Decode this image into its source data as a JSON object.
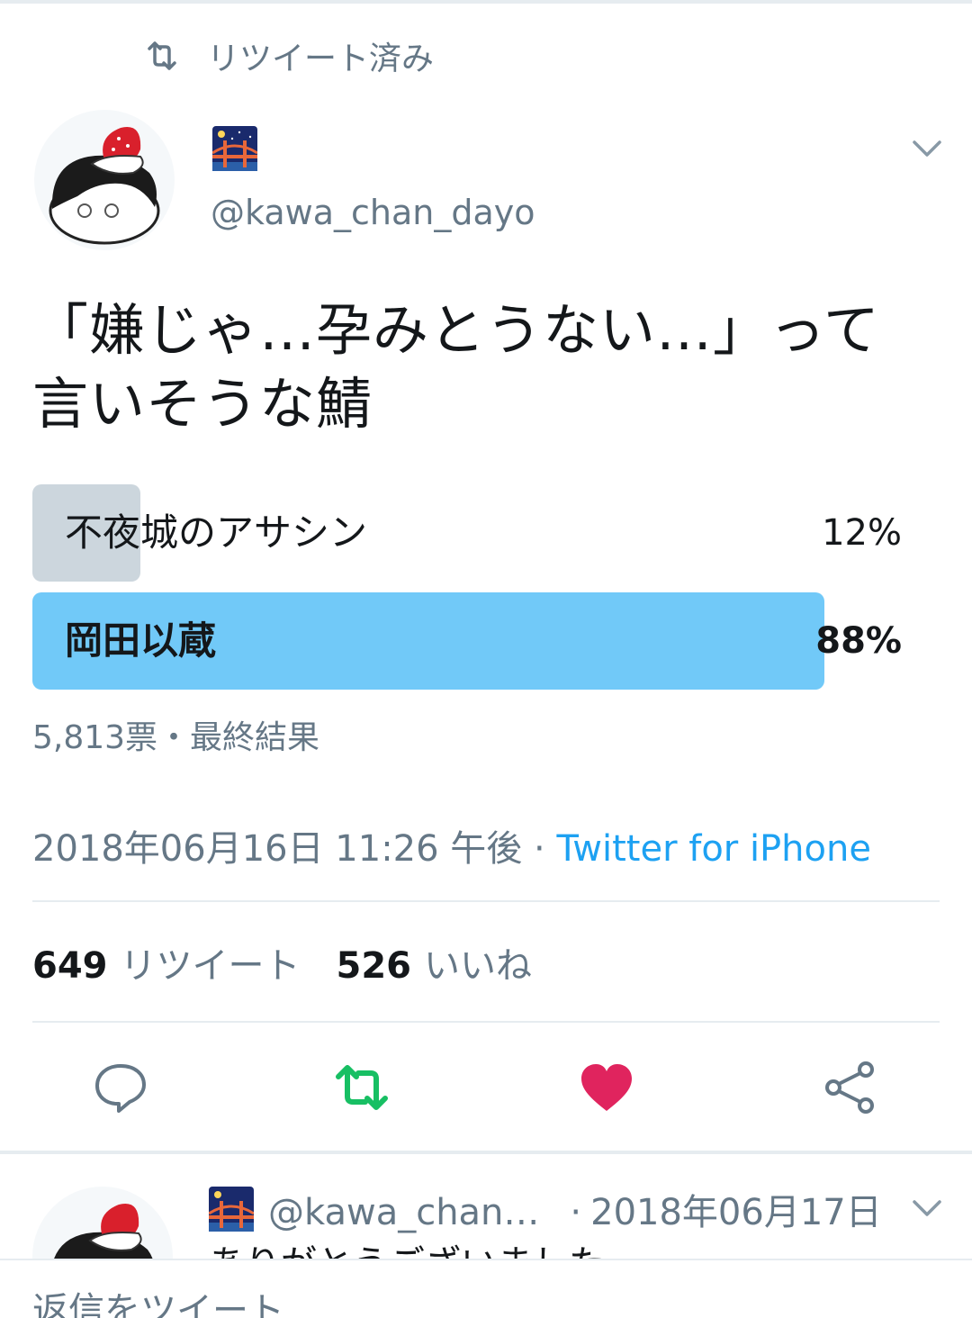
{
  "retweet_indicator": {
    "label": "リツイート済み",
    "icon": "retweet-icon"
  },
  "tweet": {
    "display_name_emoji": "bridge-at-night-emoji",
    "handle": "@kawa_chan_dayo",
    "text": "「嫌じゃ…孕みとうない…」って言いそうな鯖",
    "poll": {
      "options": [
        {
          "label": "不夜城のアサシン",
          "percent_label": "12%",
          "percent": 12
        },
        {
          "label": "岡田以蔵",
          "percent_label": "88%",
          "percent": 88
        }
      ],
      "summary": "5,813票・最終結果"
    },
    "timestamp": "2018年06月16日 11:26 午後",
    "separator": " · ",
    "source": "Twitter for iPhone",
    "stats": {
      "retweets_count": "649",
      "retweets_label": "リツイート",
      "likes_count": "526",
      "likes_label": "いいね"
    },
    "actions": [
      "reply-icon",
      "retweet-icon",
      "heart-icon",
      "share-icon"
    ],
    "colors": {
      "retweet_active": "#17bf63",
      "like_active": "#e0245e",
      "link": "#1da1f2",
      "poll_winner": "#71c9f8",
      "poll_loser": "#ccd6dd"
    }
  },
  "reply": {
    "handle": "@kawa_chan…",
    "date": "2018年06月17日",
    "dot": "·",
    "text": "ありがとうございました"
  },
  "composer": {
    "placeholder": "返信をツイート"
  }
}
